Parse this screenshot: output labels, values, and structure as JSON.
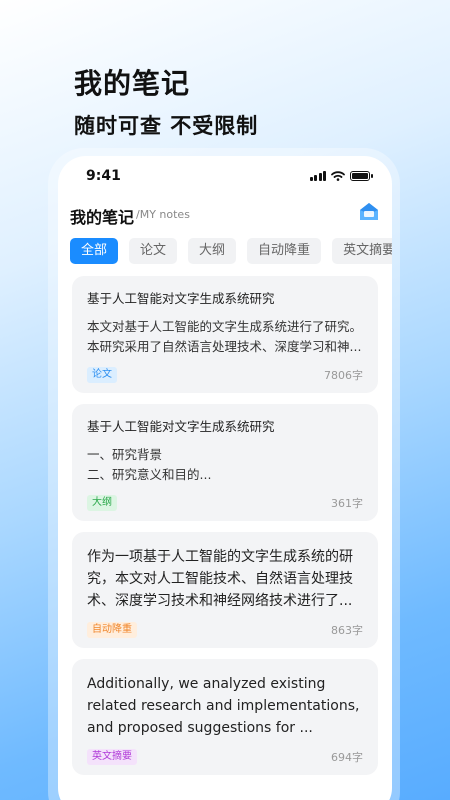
{
  "promo": {
    "title": "我的笔记",
    "subtitle": "随时可查 不受限制"
  },
  "status_bar": {
    "time": "9:41"
  },
  "header": {
    "title": "我的笔记",
    "subtitle": "/MY notes",
    "icon": "notebook-icon"
  },
  "tabs": [
    {
      "label": "全部",
      "active": true
    },
    {
      "label": "论文",
      "active": false
    },
    {
      "label": "大纲",
      "active": false
    },
    {
      "label": "自动降重",
      "active": false
    },
    {
      "label": "英文摘要",
      "active": false
    }
  ],
  "notes": [
    {
      "title": "基于人工智能对文字生成系统研究",
      "line1": "本文对基于人工智能的文字生成系统进行了研究。",
      "line2": "本研究采用了自然语言处理技术、深度学习和神...",
      "tag": "论文",
      "tag_color": "#2b8ef0",
      "tag_bg": "#dbeeff",
      "count": "7806字"
    },
    {
      "title": "基于人工智能对文字生成系统研究",
      "line1": "一、研究背景",
      "line2": "二、研究意义和目的...",
      "tag": "大纲",
      "tag_color": "#2aa84a",
      "tag_bg": "#dcf5e3",
      "count": "361字"
    },
    {
      "line1": "作为一项基于人工智能的文字生成系统的研",
      "line2": "究，本文对人工智能技术、自然语言处理技",
      "line3": "术、深度学习技术和神经网络技术进行了...",
      "tag": "自动降重",
      "tag_color": "#f0862b",
      "tag_bg": "#ffeedd",
      "count": "863字"
    },
    {
      "line1": "Additionally, we analyzed existing",
      "line2": "related research and implementations,",
      "line3": "and proposed suggestions for ...",
      "tag": "英文摘要",
      "tag_color": "#b03ad8",
      "tag_bg": "#f4e2fb",
      "count": "694字"
    }
  ],
  "colors": {
    "accent": "#1a8cff"
  }
}
